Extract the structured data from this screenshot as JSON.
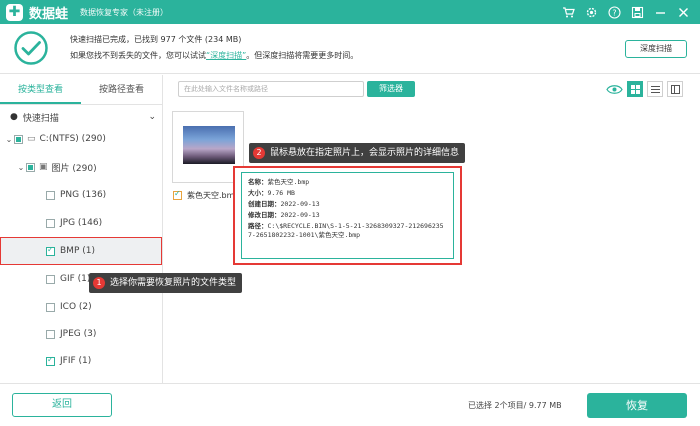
{
  "app": {
    "name": "数据蛙",
    "subtitle": "数据恢复专家（未注册）"
  },
  "titlebar_icons": [
    "cart-icon",
    "settings-icon",
    "help-icon",
    "save-icon",
    "minimize-icon",
    "close-icon"
  ],
  "header": {
    "status_line": "快速扫描已完成，已找到 977 个文件 (234 MB)",
    "hint_prefix": "如果您找不到丢失的文件，您可以试试",
    "hint_link": "“深度扫描”",
    "hint_suffix": "。但深度扫描将需要更多时间。",
    "deep_scan_button": "深度扫描"
  },
  "sidebar": {
    "tabs": [
      {
        "label": "按类型查看"
      },
      {
        "label": "按路径查看"
      }
    ],
    "quick_scan": "快速扫描",
    "tree": [
      {
        "label": "C:(NTFS) (290)"
      },
      {
        "label": "图片 (290)"
      },
      {
        "label": "PNG (136)"
      },
      {
        "label": "JPG (146)"
      },
      {
        "label": "BMP (1)"
      },
      {
        "label": "GIF (1)"
      },
      {
        "label": "ICO (2)"
      },
      {
        "label": "JPEG (3)"
      },
      {
        "label": "JFIF (1)"
      }
    ]
  },
  "toolbar": {
    "search_placeholder": "在此处输入文件名称或路径",
    "filter_button": "筛选器"
  },
  "file": {
    "name": "紫色天空.bmp"
  },
  "callouts": {
    "one": {
      "num": "1",
      "text": "选择你需要恢复照片的文件类型"
    },
    "two": {
      "num": "2",
      "text": "鼠标悬放在指定照片上，会显示照片的详细信息"
    }
  },
  "info": {
    "name_label": "名称：",
    "name_value": "紫色天空.bmp",
    "size_label": "大小：",
    "size_value": "9.76 MB",
    "created_label": "创建日期：",
    "created_value": "2022-09-13",
    "modified_label": "修改日期：",
    "modified_value": "2022-09-13",
    "path_label": "路径：",
    "path_value": "C:\\$RECYCLE.BIN\\S-1-5-21-3268309327-2126962357-2651802232-1001\\紫色天空.bmp"
  },
  "footer": {
    "back_button": "返回",
    "selection_info": "已选择 2个项目/ 9.77 MB",
    "recover_button": "恢复"
  },
  "colors": {
    "accent": "#2bb39c",
    "highlight": "#e53935"
  }
}
